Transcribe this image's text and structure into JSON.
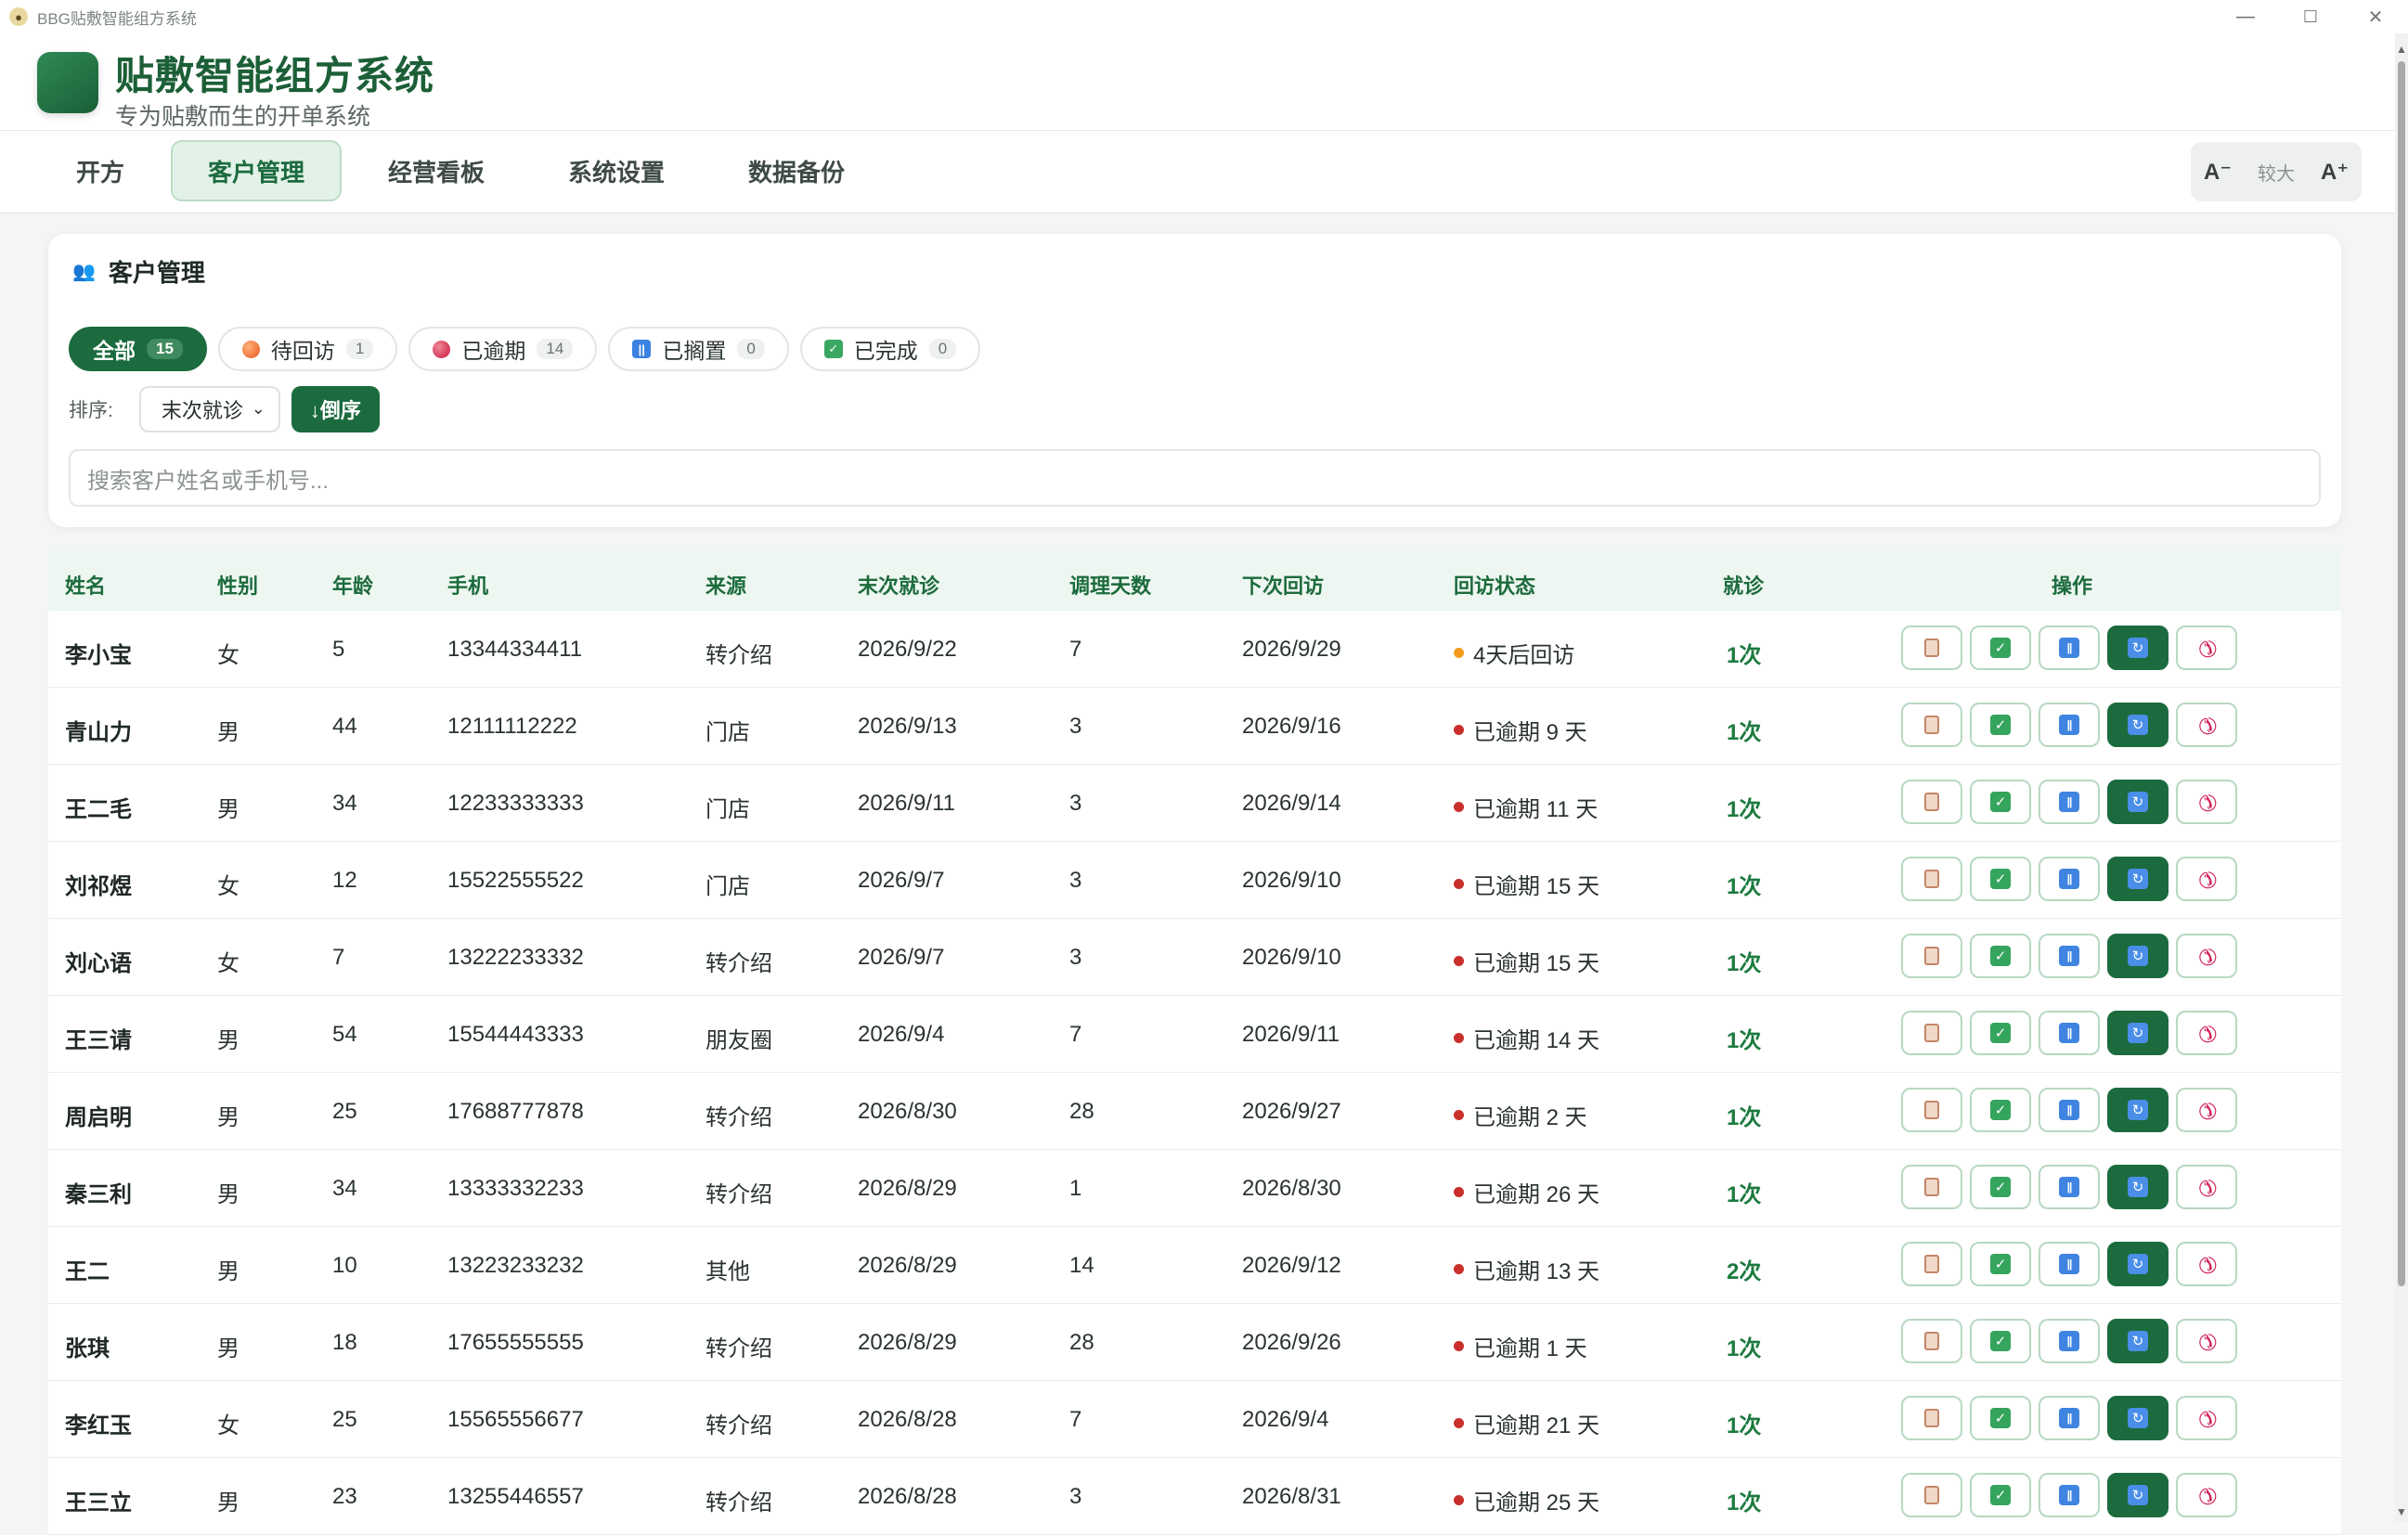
{
  "window": {
    "title": "BBG贴敷智能组方系统",
    "app_icon": "app-emblem-icon",
    "minimize": "—",
    "maximize": "☐",
    "close": "✕"
  },
  "header": {
    "title": "贴敷智能组方系统",
    "subtitle": "专为贴敷而生的开单系统"
  },
  "nav": {
    "tabs": [
      {
        "label": "开方",
        "active": false
      },
      {
        "label": "客户管理",
        "active": true
      },
      {
        "label": "经营看板",
        "active": false
      },
      {
        "label": "系统设置",
        "active": false
      },
      {
        "label": "数据备份",
        "active": false
      }
    ],
    "font_decrease": "A⁻",
    "font_level": "较大",
    "font_increase": "A⁺"
  },
  "filters": {
    "title": "客户管理",
    "chips": [
      {
        "label": "全部",
        "count": "15",
        "icon": "",
        "active": true
      },
      {
        "label": "待回访",
        "count": "1",
        "icon": "orange-circle-icon",
        "active": false
      },
      {
        "label": "已逾期",
        "count": "14",
        "icon": "red-circle-icon",
        "active": false
      },
      {
        "label": "已搁置",
        "count": "0",
        "icon": "pause-square-icon",
        "active": false
      },
      {
        "label": "已完成",
        "count": "0",
        "icon": "check-square-icon",
        "active": false
      }
    ],
    "sort_label": "排序:",
    "sort_value": "末次就诊",
    "sort_order": "↓倒序",
    "search_placeholder": "搜索客户姓名或手机号..."
  },
  "table": {
    "headers": [
      "姓名",
      "性别",
      "年龄",
      "手机",
      "来源",
      "末次就诊",
      "调理天数",
      "下次回访",
      "回访状态",
      "就诊",
      "操作"
    ],
    "rows": [
      {
        "name": "李小宝",
        "gender": "女",
        "age": "5",
        "phone": "13344334411",
        "source": "转介绍",
        "last_visit": "2026/9/22",
        "days": "7",
        "next_followup": "2026/9/29",
        "status": "4天后回访",
        "status_color": "#f29b1d",
        "visits": "1次"
      },
      {
        "name": "青山力",
        "gender": "男",
        "age": "44",
        "phone": "12111112222",
        "source": "门店",
        "last_visit": "2026/9/13",
        "days": "3",
        "next_followup": "2026/9/16",
        "status": "已逾期 9 天",
        "status_color": "#c9302c",
        "visits": "1次"
      },
      {
        "name": "王二毛",
        "gender": "男",
        "age": "34",
        "phone": "12233333333",
        "source": "门店",
        "last_visit": "2026/9/11",
        "days": "3",
        "next_followup": "2026/9/14",
        "status": "已逾期 11 天",
        "status_color": "#c9302c",
        "visits": "1次"
      },
      {
        "name": "刘祁煜",
        "gender": "女",
        "age": "12",
        "phone": "15522555522",
        "source": "门店",
        "last_visit": "2026/9/7",
        "days": "3",
        "next_followup": "2026/9/10",
        "status": "已逾期 15 天",
        "status_color": "#c9302c",
        "visits": "1次"
      },
      {
        "name": "刘心语",
        "gender": "女",
        "age": "7",
        "phone": "13222233332",
        "source": "转介绍",
        "last_visit": "2026/9/7",
        "days": "3",
        "next_followup": "2026/9/10",
        "status": "已逾期 15 天",
        "status_color": "#c9302c",
        "visits": "1次"
      },
      {
        "name": "王三请",
        "gender": "男",
        "age": "54",
        "phone": "15544443333",
        "source": "朋友圈",
        "last_visit": "2026/9/4",
        "days": "7",
        "next_followup": "2026/9/11",
        "status": "已逾期 14 天",
        "status_color": "#c9302c",
        "visits": "1次"
      },
      {
        "name": "周启明",
        "gender": "男",
        "age": "25",
        "phone": "17688777878",
        "source": "转介绍",
        "last_visit": "2026/8/30",
        "days": "28",
        "next_followup": "2026/9/27",
        "status": "已逾期 2 天",
        "status_color": "#c9302c",
        "visits": "1次"
      },
      {
        "name": "秦三利",
        "gender": "男",
        "age": "34",
        "phone": "13333332233",
        "source": "转介绍",
        "last_visit": "2026/8/29",
        "days": "1",
        "next_followup": "2026/8/30",
        "status": "已逾期 26 天",
        "status_color": "#c9302c",
        "visits": "1次"
      },
      {
        "name": "王二",
        "gender": "男",
        "age": "10",
        "phone": "13223233232",
        "source": "其他",
        "last_visit": "2026/8/29",
        "days": "14",
        "next_followup": "2026/9/12",
        "status": "已逾期 13 天",
        "status_color": "#c9302c",
        "visits": "2次"
      },
      {
        "name": "张琪",
        "gender": "男",
        "age": "18",
        "phone": "17655555555",
        "source": "转介绍",
        "last_visit": "2026/8/29",
        "days": "28",
        "next_followup": "2026/9/26",
        "status": "已逾期 1 天",
        "status_color": "#c9302c",
        "visits": "1次"
      },
      {
        "name": "李红玉",
        "gender": "女",
        "age": "25",
        "phone": "15565556677",
        "source": "转介绍",
        "last_visit": "2026/8/28",
        "days": "7",
        "next_followup": "2026/9/4",
        "status": "已逾期 21 天",
        "status_color": "#c9302c",
        "visits": "1次"
      },
      {
        "name": "王三立",
        "gender": "男",
        "age": "23",
        "phone": "13255446557",
        "source": "转介绍",
        "last_visit": "2026/8/28",
        "days": "3",
        "next_followup": "2026/8/31",
        "status": "已逾期 25 天",
        "status_color": "#c9302c",
        "visits": "1次"
      }
    ],
    "actions": [
      "clipboard-icon",
      "check-icon",
      "pause-icon",
      "refresh-icon",
      "phone-icon"
    ]
  },
  "colors": {
    "primary": "#1b6b3e",
    "accent_light": "#e3f2e8",
    "overdue": "#c9302c",
    "pending": "#f29b1d"
  }
}
